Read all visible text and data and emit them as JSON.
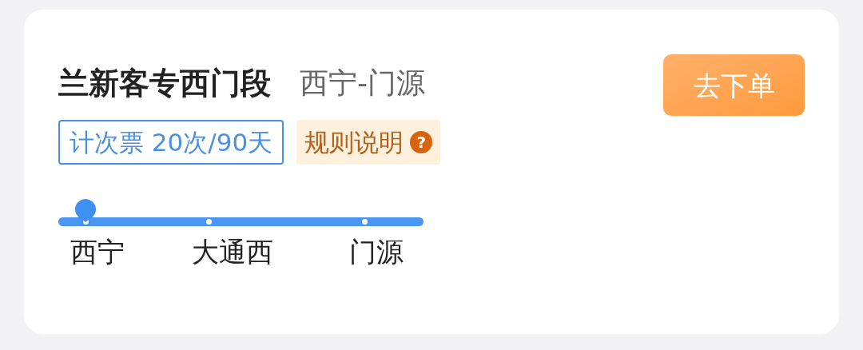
{
  "card": {
    "title": "兰新客专西门段",
    "route": "西宁-门源",
    "order_button": "去下单",
    "ticket_tag": "计次票 20次/90天",
    "rules_link": "规则说明",
    "rules_icon": "?",
    "stations": [
      {
        "name": "西宁",
        "selected": true
      },
      {
        "name": "大通西",
        "selected": false
      },
      {
        "name": "门源",
        "selected": false
      }
    ]
  }
}
